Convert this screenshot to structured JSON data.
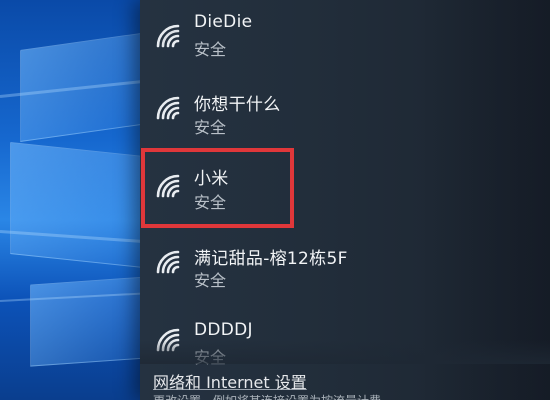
{
  "networks": [
    {
      "name": "DieDie",
      "status": "安全",
      "icon": "wifi-icon"
    },
    {
      "name": "你想干什么",
      "status": "安全",
      "icon": "wifi-icon"
    },
    {
      "name": "小米",
      "status": "安全",
      "icon": "wifi-icon",
      "highlighted": true
    },
    {
      "name": "满记甜品-榕12栋5F",
      "status": "安全",
      "icon": "wifi-icon"
    },
    {
      "name": "DDDDJ",
      "status": "安全",
      "icon": "wifi-icon"
    }
  ],
  "footer": {
    "settings_link": "网络和 Internet 设置",
    "settings_desc": "更改设置，例如将某连接设置为按流量计费"
  },
  "colors": {
    "highlight": "#e0373a",
    "panel": "#222e3b",
    "wallpaper": "#1668cf"
  }
}
